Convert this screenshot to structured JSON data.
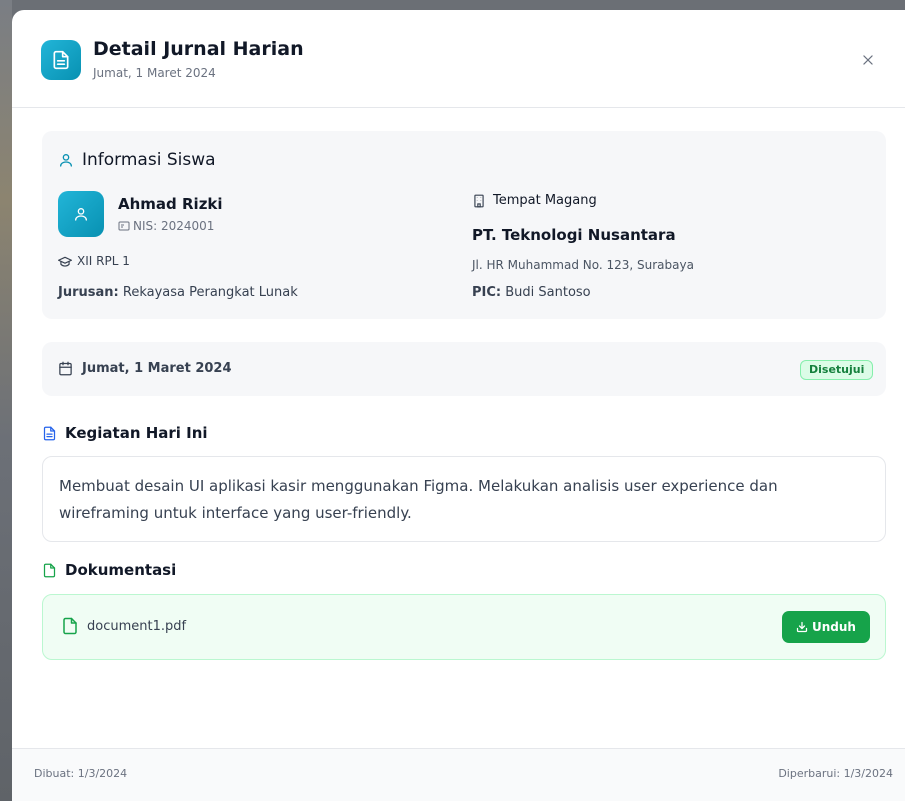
{
  "header": {
    "title": "Detail Jurnal Harian",
    "subtitle": "Jumat, 1 Maret 2024",
    "icon": "document-icon",
    "close_icon": "close-icon"
  },
  "student_info": {
    "section_title": "Informasi Siswa",
    "name": "Ahmad Rizki",
    "nis": "NIS: 2024001",
    "class": "XII RPL 1",
    "major_label": "Jurusan:",
    "major": "Rekayasa Perangkat Lunak",
    "internship_label": "Tempat Magang",
    "company": "PT. Teknologi Nusantara",
    "address": "Jl. HR Muhammad No. 123, Surabaya",
    "pic_label": "PIC:",
    "pic": "Budi Santoso"
  },
  "date_status": {
    "date": "Jumat, 1 Maret 2024",
    "status": "Disetujui"
  },
  "activity": {
    "title": "Kegiatan Hari Ini",
    "text": "Membuat desain UI aplikasi kasir menggunakan Figma. Melakukan analisis user experience dan wireframing untuk interface yang user-friendly."
  },
  "documentation": {
    "title": "Dokumentasi",
    "file_name": "document1.pdf",
    "download_label": "Unduh"
  },
  "footer": {
    "created": "Dibuat: 1/3/2024",
    "updated": "Diperbarui: 1/3/2024"
  },
  "colors": {
    "accent": "#0891b2",
    "success": "#16a34a",
    "badge_bg": "#dcfce7"
  }
}
